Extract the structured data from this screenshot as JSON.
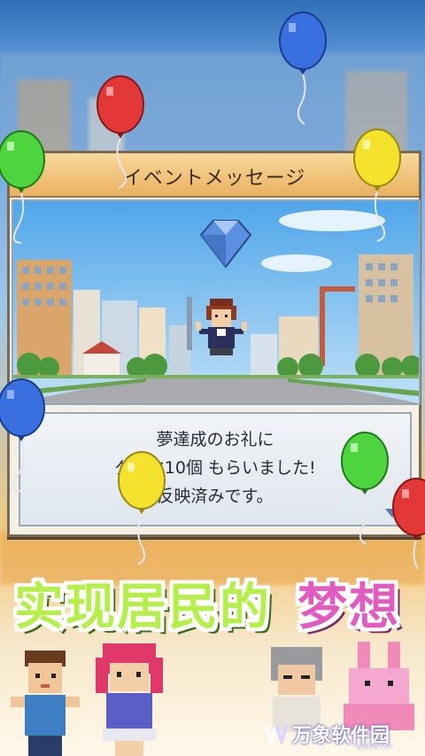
{
  "dialog": {
    "title": "イベントメッセージ",
    "message_lines": [
      "夢達成のお礼に",
      "ダイヤ10個 もらいました!",
      "反映済みです。"
    ]
  },
  "banner": {
    "main_text": "实现居民的",
    "accent_text": "梦想"
  },
  "watermark": {
    "logo_text": "万象软件园",
    "sub_text": "WXHD.VIP"
  },
  "colors": {
    "banner_main": "#b5ef4a",
    "banner_accent": "#e25bc0",
    "dialog_title_bar": "#eab161",
    "sky": "#9cc6ea"
  },
  "balloon_colors": [
    "blue",
    "red",
    "green",
    "yellow",
    "blue",
    "yellow",
    "green",
    "red"
  ]
}
